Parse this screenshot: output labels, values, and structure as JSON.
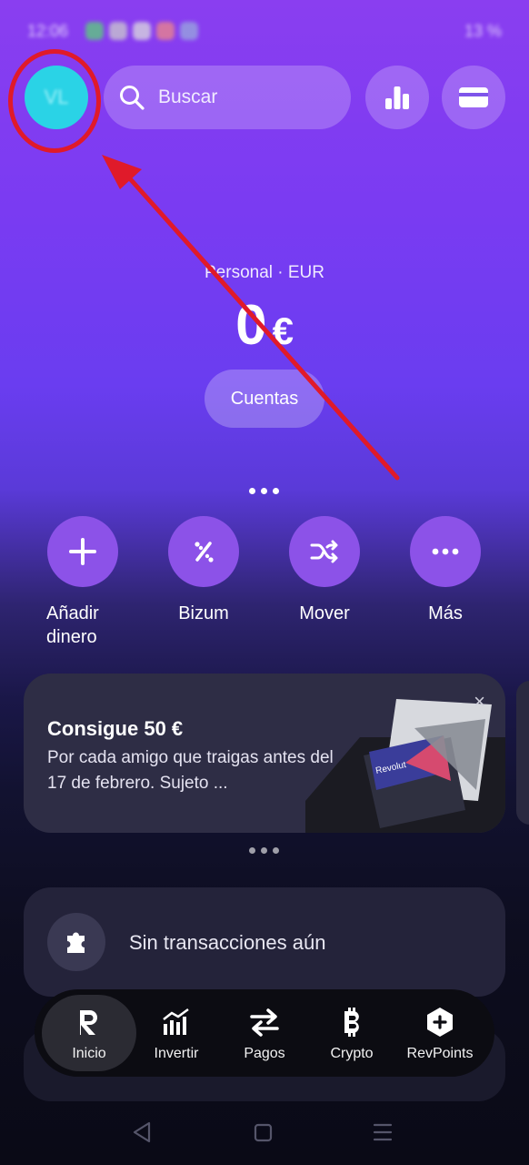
{
  "status_bar": {
    "time": "12:06",
    "battery": "13 %"
  },
  "header": {
    "avatar_initials": "VL",
    "search_placeholder": "Buscar"
  },
  "balance": {
    "account_label": "Personal · EUR",
    "amount": "0",
    "currency": "€",
    "accounts_button": "Cuentas"
  },
  "actions": [
    {
      "label": "Añadir dinero",
      "icon": "plus-icon"
    },
    {
      "label": "Bizum",
      "icon": "bizum-icon"
    },
    {
      "label": "Mover",
      "icon": "shuffle-icon"
    },
    {
      "label": "Más",
      "icon": "more-icon"
    }
  ],
  "promo": {
    "title": "Consigue 50 €",
    "description": "Por cada amigo que traigas antes del 17 de febrero. Sujeto ...",
    "close": "×",
    "card_brand": "Revolut"
  },
  "transactions": {
    "empty_label": "Sin transacciones aún"
  },
  "bottom_nav": [
    {
      "label": "Inicio",
      "icon": "revolut-r-icon",
      "active": true
    },
    {
      "label": "Invertir",
      "icon": "chart-growth-icon"
    },
    {
      "label": "Pagos",
      "icon": "transfer-arrows-icon"
    },
    {
      "label": "Crypto",
      "icon": "bitcoin-icon"
    },
    {
      "label": "RevPoints",
      "icon": "hexagon-plus-icon"
    }
  ],
  "colors": {
    "accent": "#8c52e8",
    "avatar": "#2ad3e6",
    "annotation": "#e01a2a"
  }
}
